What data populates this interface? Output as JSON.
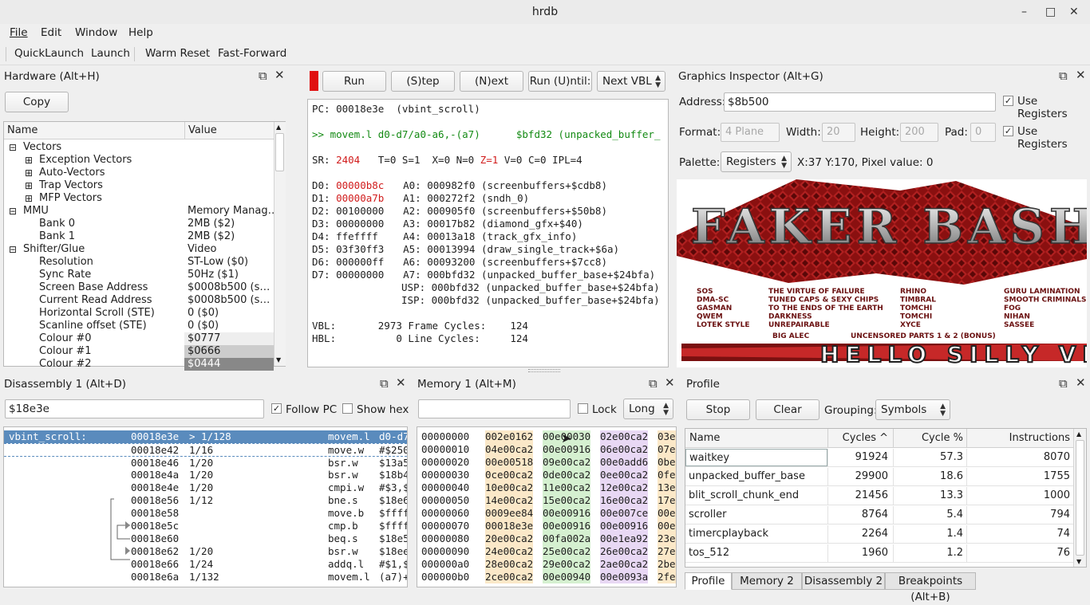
{
  "window": {
    "title": "hrdb",
    "min": "–",
    "max": "□",
    "close": "✕"
  },
  "menu": [
    "File",
    "Edit",
    "Window",
    "Help"
  ],
  "toolbar": [
    "QuickLaunch",
    "Launch",
    "Warm Reset",
    "Fast-Forward"
  ],
  "hardware": {
    "title": "Hardware (Alt+H)",
    "copy": "Copy",
    "col_name": "Name",
    "col_value": "Value",
    "rows": [
      {
        "exp": "⊟",
        "name": "Vectors",
        "value": "",
        "indent": 0
      },
      {
        "exp": "⊞",
        "name": "Exception Vectors",
        "value": "",
        "indent": 1
      },
      {
        "exp": "⊞",
        "name": "Auto-Vectors",
        "value": "",
        "indent": 1
      },
      {
        "exp": "⊞",
        "name": "Trap Vectors",
        "value": "",
        "indent": 1
      },
      {
        "exp": "⊞",
        "name": "MFP Vectors",
        "value": "",
        "indent": 1
      },
      {
        "exp": "⊟",
        "name": "MMU",
        "value": "Memory Manag…",
        "indent": 0
      },
      {
        "exp": "",
        "name": "Bank 0",
        "value": "2MB ($2)",
        "indent": 1
      },
      {
        "exp": "",
        "name": "Bank 1",
        "value": "2MB ($2)",
        "indent": 1
      },
      {
        "exp": "⊟",
        "name": "Shifter/Glue",
        "value": "Video",
        "indent": 0
      },
      {
        "exp": "",
        "name": "Resolution",
        "value": "ST-Low ($0)",
        "indent": 1
      },
      {
        "exp": "",
        "name": "Sync Rate",
        "value": "50Hz ($1)",
        "indent": 1
      },
      {
        "exp": "",
        "name": "Screen Base Address",
        "value": "$0008b500 (s…",
        "indent": 1
      },
      {
        "exp": "",
        "name": "Current Read Address",
        "value": "$0008b500 (s…",
        "indent": 1
      },
      {
        "exp": "",
        "name": "Horizontal Scroll (STE)",
        "value": "0 ($0)",
        "indent": 1
      },
      {
        "exp": "",
        "name": "Scanline offset (STE)",
        "value": "0 ($0)",
        "indent": 1
      },
      {
        "exp": "",
        "name": "Colour #0",
        "value": "$0777",
        "indent": 1,
        "bg": "#eeeeee",
        "fg": "#1e1e1e"
      },
      {
        "exp": "",
        "name": "Colour #1",
        "value": "$0666",
        "indent": 1,
        "bg": "#cccccc",
        "fg": "#1e1e1e"
      },
      {
        "exp": "",
        "name": "Colour #2",
        "value": "$0444",
        "indent": 1,
        "bg": "#888888",
        "fg": "#ffffff"
      }
    ]
  },
  "cpu": {
    "buttons": [
      "Run",
      "(S)tep",
      "(N)ext",
      "Run (U)ntil:"
    ],
    "mode": "Next VBL",
    "pc_line": "PC: 00018e3e  (vbint_scroll)",
    "instr": ">> movem.l d0-d7/a0-a6,-(a7)      $bfd32 (unpacked_buffer_",
    "sr_pre": "SR: ",
    "sr_val": "2404",
    "sr_mid": "   T=0 S=1  X=0 N=0 ",
    "sr_z": "Z=1",
    "sr_post": " V=0 C=0 IPL=4",
    "regs": [
      {
        "d": "D0:",
        "dv": "00000b8c",
        "dred": true,
        "a": "A0: 000982f0 (screenbuffers+$cdb8)"
      },
      {
        "d": "D1:",
        "dv": "00000a7b",
        "dred": true,
        "a": "A1: 000272f2 (sndh_0)"
      },
      {
        "d": "D2:",
        "dv": "00100000",
        "dred": false,
        "a": "A2: 000905f0 (screenbuffers+$50b8)"
      },
      {
        "d": "D3:",
        "dv": "00000000",
        "dred": false,
        "a": "A3: 00017b82 (diamond_gfx+$40)"
      },
      {
        "d": "D4:",
        "dv": "ffeffff",
        "dred": false,
        "a": "A4: 00013a18 (track_gfx_info)"
      },
      {
        "d": "D5:",
        "dv": "03f30ff3",
        "dred": false,
        "a": "A5: 00013994 (draw_single_track+$6a)"
      },
      {
        "d": "D6:",
        "dv": "000000ff",
        "dred": false,
        "a": "A6: 00093200 (screenbuffers+$7cc8)"
      },
      {
        "d": "D7:",
        "dv": "00000000",
        "dred": false,
        "a": "A7: 000bfd32 (unpacked_buffer_base+$24bfa)"
      }
    ],
    "usp": "USP: 000bfd32 (unpacked_buffer_base+$24bfa)",
    "isp": "ISP: 000bfd32 (unpacked_buffer_base+$24bfa)",
    "vbl": "VBL:       2973 Frame Cycles:    124",
    "hbl": "HBL:          0 Line Cycles:     124"
  },
  "gfx": {
    "title": "Graphics Inspector (Alt+G)",
    "address_label": "Address:",
    "address": "$8b500",
    "use_registers": "Use Registers",
    "format_label": "Format:",
    "format": "4 Plane",
    "width_label": "Width:",
    "width": "20",
    "height_label": "Height:",
    "height": "200",
    "pad_label": "Pad:",
    "pad": "0",
    "palette_label": "Palette:",
    "palette": "Registers",
    "status": "X:37 Y:170, Pixel value: 0",
    "img": {
      "logo": "FAKER BASHING",
      "credits_left": [
        "SOS",
        "DMA-SC",
        "GASMAN",
        "QWEM",
        "LOTEK STYLE"
      ],
      "credits_mid": [
        "THE VIRTUE OF FAILURE",
        "TUNED CAPS & SEXY CHIPS",
        "TO THE ENDS OF THE EARTH",
        "DARKNESS",
        "UNREPAIRABLE"
      ],
      "credits_right": [
        "RHINO",
        "TIMBRAL",
        "TOMCHI",
        "TOMCHI",
        "XYCE"
      ],
      "credits_far": [
        "GURU LAMINATION",
        "SMOOTH CRIMINALS",
        "FOG",
        "NIHAN",
        "SASSEE"
      ],
      "foot": [
        "BIG ALEC",
        "UNCENSORED PARTS 1 & 2 (BONUS)"
      ],
      "scroller": "HELLO SILLY VEN"
    }
  },
  "disasm": {
    "title": "Disassembly 1 (Alt+D)",
    "address": "$18e3e",
    "follow_pc": "Follow PC",
    "show_hex": "Show hex",
    "rows": [
      {
        "sym": "vbint_scroll:",
        "addr": "00018e3e",
        "cyc": "> 1/128",
        "op": "movem.l",
        "arg": "d0-d7",
        "sel": true
      },
      {
        "sym": "",
        "addr": "00018e42",
        "cyc": "1/16",
        "op": "move.w",
        "arg": "#$250"
      },
      {
        "sym": "",
        "addr": "00018e46",
        "cyc": "1/20",
        "op": "bsr.w",
        "arg": "$13a5"
      },
      {
        "sym": "",
        "addr": "00018e4a",
        "cyc": "1/20",
        "op": "bsr.w",
        "arg": "$18b4"
      },
      {
        "sym": "",
        "addr": "00018e4e",
        "cyc": "1/20",
        "op": "cmpi.w",
        "arg": "#$3,$"
      },
      {
        "sym": "",
        "addr": "00018e56",
        "cyc": "1/12",
        "op": "bne.s",
        "arg": "$18e6"
      },
      {
        "sym": "",
        "addr": "00018e58",
        "cyc": "",
        "op": "move.b",
        "arg": "$ffff"
      },
      {
        "sym": "",
        "addr": "00018e5c",
        "cyc": "",
        "op": "cmp.b",
        "arg": "$ffff"
      },
      {
        "sym": "",
        "addr": "00018e60",
        "cyc": "",
        "op": "beq.s",
        "arg": "$18e5"
      },
      {
        "sym": "",
        "addr": "00018e62",
        "cyc": "1/20",
        "op": "bsr.w",
        "arg": "$18ee"
      },
      {
        "sym": "",
        "addr": "00018e66",
        "cyc": "1/24",
        "op": "addq.l",
        "arg": "#$1,$"
      },
      {
        "sym": "",
        "addr": "00018e6a",
        "cyc": "1/132",
        "op": "movem.l",
        "arg": "(a7)+"
      }
    ]
  },
  "memory": {
    "title": "Memory 1 (Alt+M)",
    "address": "",
    "lock": "Lock",
    "mode": "Long",
    "rows": [
      {
        "a": "00000000",
        "w": [
          "002e0162",
          "00e00030",
          "02e00ca2",
          "03e"
        ]
      },
      {
        "a": "00000010",
        "w": [
          "04e00ca2",
          "00e00916",
          "06e00ca2",
          "07e"
        ]
      },
      {
        "a": "00000020",
        "w": [
          "00e00518",
          "09e00ca2",
          "00e0add6",
          "0be"
        ]
      },
      {
        "a": "00000030",
        "w": [
          "0ce00ca2",
          "0de00ca2",
          "0ee00ca2",
          "0fe"
        ]
      },
      {
        "a": "00000040",
        "w": [
          "10e00ca2",
          "11e00ca2",
          "12e00ca2",
          "13e"
        ]
      },
      {
        "a": "00000050",
        "w": [
          "14e00ca2",
          "15e00ca2",
          "16e00ca2",
          "17e"
        ]
      },
      {
        "a": "00000060",
        "w": [
          "0009ee84",
          "00e00916",
          "00e007ce",
          "00e"
        ]
      },
      {
        "a": "00000070",
        "w": [
          "00018e3e",
          "00e00916",
          "00e00916",
          "00e"
        ]
      },
      {
        "a": "00000080",
        "w": [
          "20e00ca2",
          "00fa002a",
          "00e1ea92",
          "23e"
        ]
      },
      {
        "a": "00000090",
        "w": [
          "24e00ca2",
          "25e00ca2",
          "26e00ca2",
          "27e"
        ]
      },
      {
        "a": "000000a0",
        "w": [
          "28e00ca2",
          "29e00ca2",
          "2ae00ca2",
          "2be"
        ]
      },
      {
        "a": "000000b0",
        "w": [
          "2ce00ca2",
          "00e00940",
          "00e0093a",
          "2fe"
        ]
      }
    ],
    "colbg": [
      "#fbe8c8",
      "#d5f0d0",
      "#e8d8f4",
      "#fbe8c8"
    ]
  },
  "profile": {
    "title": "Profile",
    "stop": "Stop",
    "clear": "Clear",
    "grouping_label": "Grouping:",
    "grouping": "Symbols",
    "cols": [
      "Name",
      "Cycles ^",
      "Cycle %",
      "Instructions"
    ],
    "rows": [
      {
        "n": "waitkey",
        "c": "91924",
        "p": "57.3",
        "i": "8070"
      },
      {
        "n": "unpacked_buffer_base",
        "c": "29900",
        "p": "18.6",
        "i": "1755"
      },
      {
        "n": "blit_scroll_chunk_end",
        "c": "21456",
        "p": "13.3",
        "i": "1000"
      },
      {
        "n": "scroller",
        "c": "8764",
        "p": "5.4",
        "i": "794"
      },
      {
        "n": "timercplayback",
        "c": "2264",
        "p": "1.4",
        "i": "74"
      },
      {
        "n": "tos_512",
        "c": "1960",
        "p": "1.2",
        "i": "76"
      }
    ]
  },
  "tabs": [
    "Profile",
    "Memory 2",
    "Disassembly 2",
    "Breakpoints (Alt+B)"
  ],
  "colors": {
    "accent": "#4a7fb5",
    "selection": "#5a8bbd",
    "run_indicator": "#e01010",
    "reg_changed": "#d11c1c",
    "instr_green": "#138a13"
  }
}
